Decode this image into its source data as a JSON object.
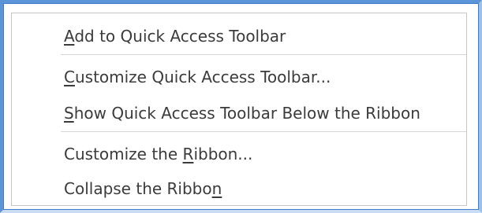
{
  "context_menu": {
    "items": [
      {
        "pre": "",
        "key": "A",
        "post": "dd to Quick Access Toolbar"
      },
      {
        "pre": "",
        "key": "C",
        "post": "ustomize Quick Access Toolbar..."
      },
      {
        "pre": "",
        "key": "S",
        "post": "how Quick Access Toolbar Below the Ribbon"
      },
      {
        "pre": "Customize the ",
        "key": "R",
        "post": "ibbon..."
      },
      {
        "pre": "Collapse the Ribbo",
        "key": "n",
        "post": ""
      }
    ]
  },
  "colors": {
    "frame_blue": "#5b95d8",
    "text": "#3b3b3b",
    "separator": "#d6d6d6"
  }
}
